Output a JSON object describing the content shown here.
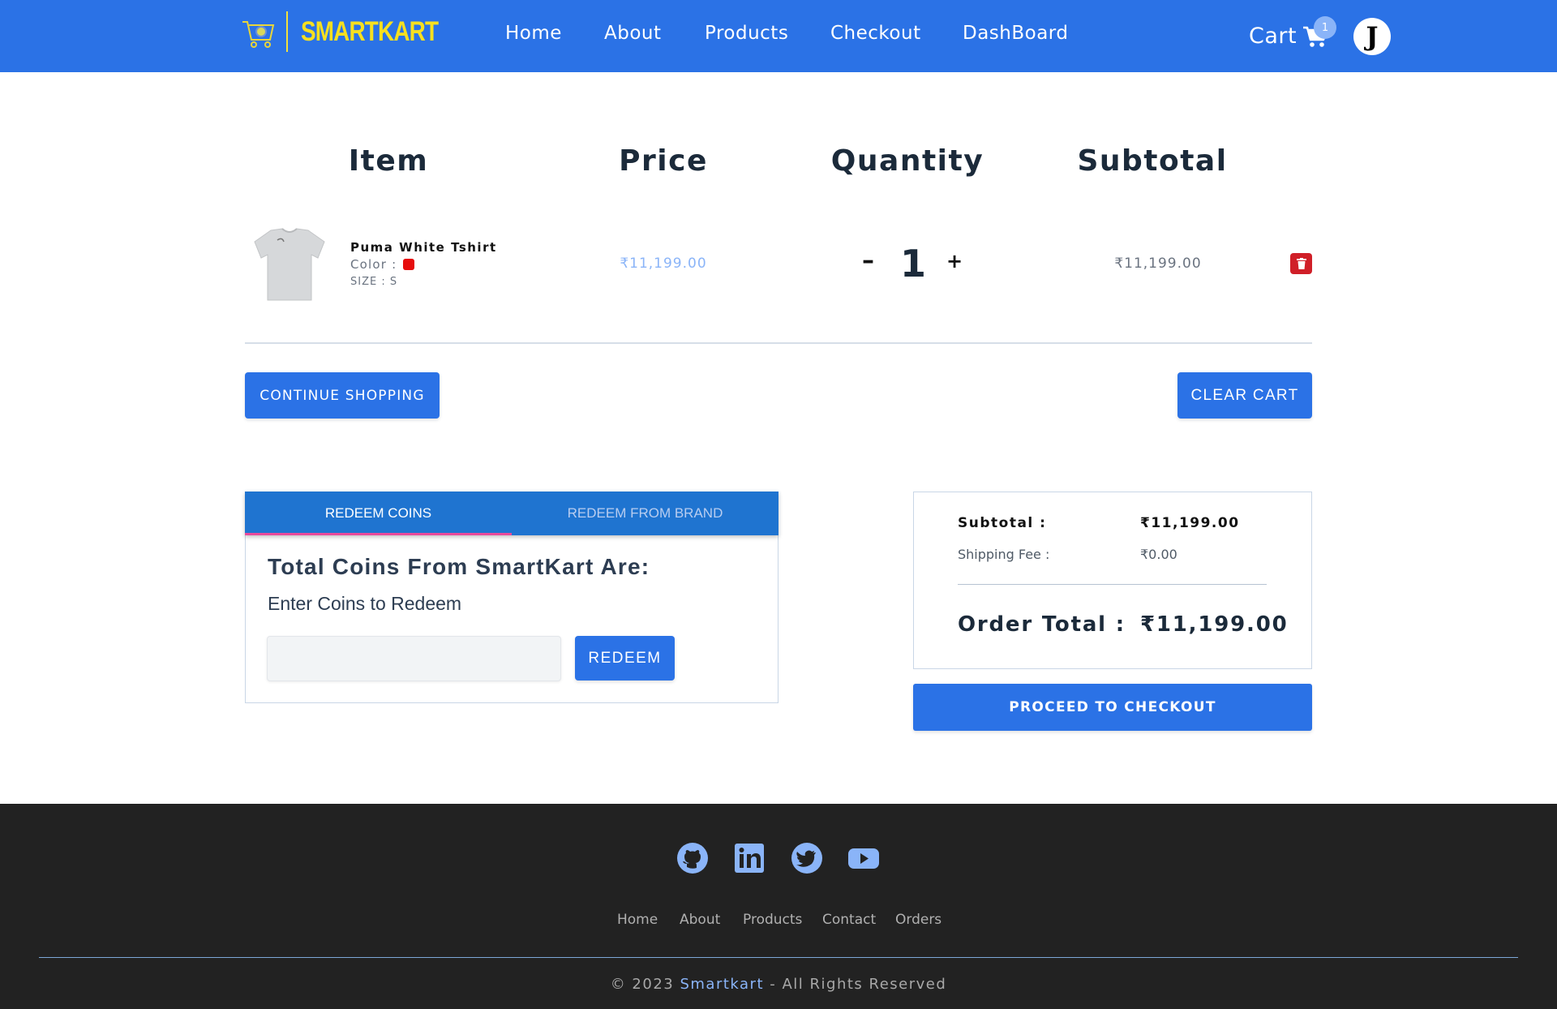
{
  "header": {
    "brand": "SMARTKART",
    "nav": [
      "Home",
      "About",
      "Products",
      "Checkout",
      "DashBoard"
    ],
    "cart_label": "Cart",
    "cart_count": "1",
    "avatar_initial": "J"
  },
  "cart": {
    "columns": {
      "item": "Item",
      "price": "Price",
      "quantity": "Quantity",
      "subtotal": "Subtotal"
    },
    "items": [
      {
        "name": "Puma White Tshirt",
        "color_label": "Color :",
        "color": "#e60d0d",
        "size": "SIZE : S",
        "price": "₹11,199.00",
        "quantity": "1",
        "qty_minus": "–",
        "qty_plus": "+",
        "subtotal": "₹11,199.00"
      }
    ],
    "continue_label": "CONTINUE SHOPPING",
    "clear_label": "CLEAR CART"
  },
  "redeem": {
    "tabs": [
      "REDEEM COINS",
      "REDEEM FROM BRAND"
    ],
    "title": "Total Coins From SmartKart Are:",
    "input_label": "Enter Coins to Redeem",
    "input_value": "",
    "button_label": "REDEEM"
  },
  "summary": {
    "subtotal_label": "Subtotal :",
    "subtotal_value": "₹11,199.00",
    "shipping_label": "Shipping Fee :",
    "shipping_value": "₹0.00",
    "total_label": "Order Total :",
    "total_value": "₹11,199.00",
    "checkout_label": "PROCEED TO CHECKOUT"
  },
  "footer": {
    "social": [
      "github-icon",
      "linkedin-icon",
      "twitter-icon",
      "youtube-icon"
    ],
    "links": [
      "Home",
      "About",
      "Products",
      "Contact",
      "Orders"
    ],
    "copyright_prefix": "© 2023",
    "copyright_brand": "Smartkart",
    "copyright_suffix": "- All Rights Reserved"
  },
  "colors": {
    "primary": "#2b72e6",
    "brand_yellow": "#f7e01f",
    "danger": "#d01f28",
    "footer_bg": "#222222",
    "link_blue": "#8ab4f8"
  }
}
